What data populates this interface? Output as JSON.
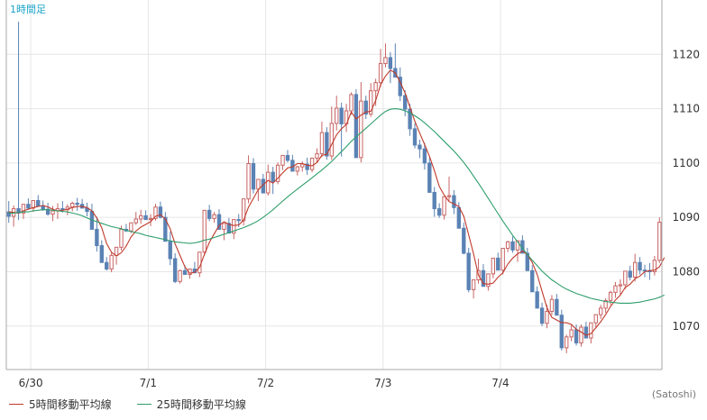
{
  "period_label": "1時間足",
  "credit": "(Satoshi)",
  "colors": {
    "up": "#c86464",
    "down": "#5a82b4",
    "ma5": "#c0392b",
    "ma25": "#2e9e6b",
    "grid": "#e6e6e6",
    "axis": "#aaaaaa",
    "label": "#1aa3c8"
  },
  "chart_data": {
    "type": "candlestick",
    "title": "",
    "xlabel": "",
    "ylabel": "",
    "ylim": [
      1062,
      1130
    ],
    "grid": true,
    "legend_position": "bottom-left",
    "y_ticks": [
      1070,
      1080,
      1090,
      1100,
      1110,
      1120
    ],
    "x_ticks": [
      "6/30",
      "7/1",
      "7/2",
      "7/3",
      "7/4"
    ],
    "ohlc": [
      [
        1091.0,
        1093.0,
        1089.0,
        1090.2
      ],
      [
        1090.2,
        1092.2,
        1088.3,
        1091.6
      ],
      [
        1091.6,
        1126.0,
        1089.5,
        1090.8
      ],
      [
        1090.8,
        1091.8,
        1089.7,
        1092.4
      ],
      [
        1092.4,
        1093.5,
        1091.4,
        1091.7
      ],
      [
        1091.7,
        1092.7,
        1091.0,
        1093.1
      ],
      [
        1093.1,
        1094.1,
        1092.5,
        1092.1
      ],
      [
        1092.1,
        1093.1,
        1091.2,
        1091.5
      ],
      [
        1091.5,
        1092.7,
        1090.3,
        1090.6
      ],
      [
        1090.6,
        1092.1,
        1089.3,
        1091.2
      ],
      [
        1091.2,
        1092.6,
        1089.7,
        1091.6
      ],
      [
        1091.6,
        1093.0,
        1090.9,
        1091.4
      ],
      [
        1091.4,
        1092.4,
        1090.4,
        1091.9
      ],
      [
        1091.9,
        1092.9,
        1091.1,
        1092.6
      ],
      [
        1092.6,
        1093.6,
        1091.2,
        1092.4
      ],
      [
        1092.4,
        1093.4,
        1091.9,
        1091.7
      ],
      [
        1091.7,
        1092.7,
        1090.2,
        1091.1
      ],
      [
        1091.1,
        1092.5,
        1088.9,
        1087.8
      ],
      [
        1087.8,
        1090.1,
        1083.7,
        1084.8
      ],
      [
        1084.8,
        1085.8,
        1083.5,
        1081.7
      ],
      [
        1081.7,
        1082.7,
        1080.2,
        1080.5
      ],
      [
        1080.5,
        1083.6,
        1079.9,
        1083.0
      ],
      [
        1083.0,
        1084.0,
        1081.3,
        1084.5
      ],
      [
        1084.5,
        1088.5,
        1083.9,
        1087.8
      ],
      [
        1087.8,
        1088.8,
        1087.3,
        1087.5
      ],
      [
        1087.5,
        1088.6,
        1087.1,
        1089.0
      ],
      [
        1089.0,
        1091.0,
        1088.6,
        1089.7
      ],
      [
        1089.7,
        1091.4,
        1088.8,
        1090.3
      ],
      [
        1090.3,
        1091.3,
        1089.6,
        1089.6
      ],
      [
        1089.6,
        1090.6,
        1088.4,
        1089.8
      ],
      [
        1089.8,
        1092.5,
        1089.4,
        1091.9
      ],
      [
        1091.9,
        1092.9,
        1089.8,
        1090.0
      ],
      [
        1090.0,
        1091.0,
        1087.6,
        1085.6
      ],
      [
        1085.6,
        1087.4,
        1081.2,
        1082.4
      ],
      [
        1082.4,
        1083.4,
        1077.9,
        1078.2
      ],
      [
        1078.2,
        1080.4,
        1077.8,
        1080.2
      ],
      [
        1080.2,
        1081.2,
        1079.6,
        1079.5
      ],
      [
        1079.5,
        1080.5,
        1078.7,
        1080.5
      ],
      [
        1080.5,
        1081.8,
        1079.8,
        1079.8
      ],
      [
        1079.8,
        1081.6,
        1079.0,
        1083.6
      ],
      [
        1083.6,
        1086.5,
        1083.0,
        1091.3
      ],
      [
        1091.3,
        1092.3,
        1089.3,
        1089.8
      ],
      [
        1089.8,
        1091.0,
        1089.0,
        1090.5
      ],
      [
        1090.5,
        1091.5,
        1088.3,
        1087.8
      ],
      [
        1087.8,
        1088.8,
        1085.8,
        1088.9
      ],
      [
        1088.9,
        1089.9,
        1087.4,
        1087.1
      ],
      [
        1087.1,
        1088.3,
        1086.0,
        1089.6
      ],
      [
        1089.6,
        1090.6,
        1088.2,
        1089.4
      ],
      [
        1089.4,
        1092.4,
        1088.5,
        1093.4
      ],
      [
        1093.4,
        1101.4,
        1092.6,
        1099.9
      ],
      [
        1099.9,
        1100.9,
        1094.4,
        1095.2
      ],
      [
        1095.2,
        1096.2,
        1093.0,
        1097.0
      ],
      [
        1097.0,
        1098.0,
        1094.4,
        1094.5
      ],
      [
        1094.5,
        1099.7,
        1094.0,
        1098.3
      ],
      [
        1098.3,
        1099.3,
        1094.3,
        1096.6
      ],
      [
        1096.6,
        1100.1,
        1096.1,
        1099.6
      ],
      [
        1099.6,
        1101.0,
        1098.7,
        1101.4
      ],
      [
        1101.4,
        1102.4,
        1100.1,
        1100.5
      ],
      [
        1100.5,
        1101.5,
        1098.6,
        1098.5
      ],
      [
        1098.5,
        1099.5,
        1097.7,
        1099.3
      ],
      [
        1099.3,
        1100.3,
        1098.4,
        1099.8
      ],
      [
        1099.8,
        1101.0,
        1097.8,
        1098.8
      ],
      [
        1098.8,
        1101.0,
        1098.3,
        1100.9
      ],
      [
        1100.9,
        1102.7,
        1100.1,
        1101.7
      ],
      [
        1101.7,
        1107.6,
        1101.1,
        1105.6
      ],
      [
        1105.6,
        1106.6,
        1100.6,
        1101.3
      ],
      [
        1101.3,
        1110.4,
        1100.6,
        1107.3
      ],
      [
        1107.3,
        1112.4,
        1106.0,
        1110.1
      ],
      [
        1110.1,
        1111.1,
        1101.2,
        1107.2
      ],
      [
        1107.2,
        1110.9,
        1105.7,
        1109.6
      ],
      [
        1109.6,
        1113.0,
        1108.9,
        1112.6
      ],
      [
        1112.6,
        1113.6,
        1102.4,
        1101.0
      ],
      [
        1101.0,
        1114.9,
        1100.1,
        1111.4
      ],
      [
        1111.4,
        1112.4,
        1108.1,
        1109.0
      ],
      [
        1109.0,
        1114.7,
        1108.5,
        1113.3
      ],
      [
        1113.3,
        1115.5,
        1110.5,
        1114.8
      ],
      [
        1114.8,
        1121.0,
        1114.0,
        1118.3
      ],
      [
        1118.3,
        1122.0,
        1117.6,
        1119.4
      ],
      [
        1119.4,
        1120.4,
        1114.7,
        1117.4
      ],
      [
        1117.4,
        1122.0,
        1116.5,
        1115.8
      ],
      [
        1115.8,
        1117.6,
        1111.4,
        1112.4
      ],
      [
        1112.4,
        1113.4,
        1108.6,
        1109.9
      ],
      [
        1109.9,
        1110.9,
        1105.0,
        1106.3
      ],
      [
        1106.3,
        1107.3,
        1102.7,
        1103.3
      ],
      [
        1103.3,
        1104.3,
        1100.9,
        1102.6
      ],
      [
        1102.6,
        1103.7,
        1098.8,
        1100.0
      ],
      [
        1100.0,
        1101.0,
        1095.1,
        1094.6
      ],
      [
        1094.6,
        1095.6,
        1090.1,
        1091.6
      ],
      [
        1091.6,
        1092.6,
        1089.9,
        1090.4
      ],
      [
        1090.4,
        1093.0,
        1089.6,
        1093.8
      ],
      [
        1093.8,
        1097.5,
        1093.0,
        1094.0
      ],
      [
        1094.0,
        1095.0,
        1090.6,
        1091.8
      ],
      [
        1091.8,
        1092.8,
        1088.3,
        1088.0
      ],
      [
        1088.0,
        1089.0,
        1083.2,
        1083.4
      ],
      [
        1083.4,
        1084.4,
        1076.2,
        1076.7
      ],
      [
        1076.7,
        1077.7,
        1075.1,
        1078.5
      ],
      [
        1078.5,
        1082.4,
        1077.8,
        1080.2
      ],
      [
        1080.2,
        1081.4,
        1077.5,
        1077.3
      ],
      [
        1077.3,
        1078.3,
        1076.5,
        1079.6
      ],
      [
        1079.6,
        1081.0,
        1078.8,
        1082.5
      ],
      [
        1082.5,
        1083.5,
        1080.8,
        1080.3
      ],
      [
        1080.3,
        1083.7,
        1079.5,
        1084.3
      ],
      [
        1084.3,
        1085.7,
        1083.6,
        1085.5
      ],
      [
        1085.5,
        1086.5,
        1083.5,
        1084.0
      ],
      [
        1084.0,
        1085.0,
        1081.8,
        1085.7
      ],
      [
        1085.7,
        1086.7,
        1083.4,
        1083.4
      ],
      [
        1083.4,
        1084.4,
        1080.5,
        1080.2
      ],
      [
        1080.2,
        1081.2,
        1076.5,
        1076.3
      ],
      [
        1076.3,
        1077.3,
        1074.5,
        1073.3
      ],
      [
        1073.3,
        1074.3,
        1070.0,
        1070.5
      ],
      [
        1070.5,
        1073.9,
        1069.6,
        1072.7
      ],
      [
        1072.7,
        1075.7,
        1072.0,
        1074.9
      ],
      [
        1074.9,
        1075.9,
        1072.2,
        1072.0
      ],
      [
        1072.0,
        1073.0,
        1065.5,
        1066.0
      ],
      [
        1066.0,
        1068.4,
        1065.0,
        1068.0
      ],
      [
        1068.0,
        1070.2,
        1067.2,
        1069.3
      ],
      [
        1069.3,
        1070.3,
        1066.4,
        1066.9
      ],
      [
        1066.9,
        1070.3,
        1066.2,
        1069.8
      ],
      [
        1069.8,
        1070.8,
        1068.2,
        1067.8
      ],
      [
        1067.8,
        1070.1,
        1066.8,
        1070.6
      ],
      [
        1070.6,
        1072.2,
        1069.8,
        1072.1
      ],
      [
        1072.1,
        1073.9,
        1071.3,
        1073.3
      ],
      [
        1073.3,
        1075.1,
        1072.4,
        1074.7
      ],
      [
        1074.7,
        1076.5,
        1073.9,
        1076.2
      ],
      [
        1076.2,
        1078.1,
        1075.2,
        1077.4
      ],
      [
        1077.4,
        1078.6,
        1075.8,
        1077.6
      ],
      [
        1077.6,
        1080.0,
        1076.8,
        1080.1
      ],
      [
        1080.1,
        1081.1,
        1078.4,
        1079.0
      ],
      [
        1079.0,
        1083.3,
        1078.2,
        1081.7
      ],
      [
        1081.7,
        1082.7,
        1079.5,
        1080.3
      ],
      [
        1080.3,
        1081.3,
        1079.0,
        1080.2
      ],
      [
        1080.2,
        1081.6,
        1078.5,
        1080.0
      ],
      [
        1080.0,
        1082.9,
        1079.3,
        1082.1
      ],
      [
        1082.1,
        1090.0,
        1081.6,
        1089.1
      ]
    ],
    "series": [
      {
        "name": "5時間移動平均線",
        "values": [
          1091.0,
          1090.9,
          1090.8,
          1091.2,
          1091.5,
          1091.8,
          1092.0,
          1092.2,
          1091.9,
          1091.5,
          1091.2,
          1091.3,
          1091.5,
          1091.8,
          1092.0,
          1092.0,
          1091.8,
          1091.2,
          1089.9,
          1088.1,
          1085.2,
          1083.6,
          1082.9,
          1083.5,
          1084.7,
          1086.4,
          1087.5,
          1088.2,
          1088.7,
          1089.2,
          1090.2,
          1090.5,
          1089.7,
          1087.9,
          1085.1,
          1083.0,
          1080.9,
          1079.7,
          1079.9,
          1080.8,
          1083.2,
          1085.4,
          1087.0,
          1088.5,
          1089.2,
          1088.7,
          1088.5,
          1088.6,
          1089.5,
          1091.9,
          1093.5,
          1095.1,
          1096.0,
          1096.8,
          1096.3,
          1097.2,
          1098.2,
          1099.1,
          1099.3,
          1099.9,
          1099.9,
          1099.6,
          1099.5,
          1100.1,
          1101.4,
          1101.6,
          1103.4,
          1105.2,
          1106.3,
          1107.1,
          1109.4,
          1108.1,
          1108.8,
          1109.4,
          1109.5,
          1111.5,
          1114.4,
          1116.0,
          1117.1,
          1116.6,
          1114.9,
          1112.9,
          1110.3,
          1107.7,
          1105.5,
          1103.4,
          1101.2,
          1098.6,
          1095.7,
          1094.1,
          1092.9,
          1092.5,
          1092.0,
          1090.2,
          1086.8,
          1083.3,
          1079.4,
          1077.8,
          1077.7,
          1077.9,
          1079.0,
          1079.8,
          1081.4,
          1082.5,
          1083.3,
          1083.8,
          1083.2,
          1081.7,
          1079.5,
          1076.4,
          1073.4,
          1071.6,
          1071.1,
          1070.6,
          1070.6,
          1070.3,
          1069.4,
          1068.9,
          1068.3,
          1068.6,
          1069.7,
          1070.8,
          1072.1,
          1073.6,
          1074.8,
          1075.7,
          1077.1,
          1077.7,
          1078.7,
          1079.2,
          1080.0,
          1080.2,
          1080.3,
          1080.9,
          1082.6
        ]
      },
      {
        "name": "25時間移動平均線",
        "values": [
          1090.8,
          1090.8,
          1090.9,
          1091.0,
          1091.0,
          1091.2,
          1091.3,
          1091.4,
          1091.4,
          1091.3,
          1091.2,
          1091.1,
          1091.0,
          1090.8,
          1090.6,
          1090.3,
          1089.9,
          1089.5,
          1089.2,
          1088.9,
          1088.6,
          1088.3,
          1088.1,
          1087.9,
          1087.6,
          1087.4,
          1087.2,
          1087.0,
          1086.7,
          1086.5,
          1086.3,
          1086.1,
          1085.9,
          1085.7,
          1085.5,
          1085.4,
          1085.3,
          1085.2,
          1085.3,
          1085.5,
          1085.8,
          1086.0,
          1086.3,
          1086.6,
          1086.9,
          1087.2,
          1087.5,
          1087.8,
          1088.1,
          1088.5,
          1088.9,
          1089.4,
          1090.0,
          1090.7,
          1091.4,
          1092.2,
          1093.0,
          1093.8,
          1094.5,
          1095.2,
          1095.9,
          1096.6,
          1097.3,
          1098.0,
          1098.7,
          1099.5,
          1100.3,
          1101.2,
          1102.1,
          1103.0,
          1104.0,
          1104.8,
          1105.6,
          1106.4,
          1107.2,
          1108.0,
          1108.8,
          1109.5,
          1109.9,
          1110.0,
          1109.9,
          1109.6,
          1109.2,
          1108.7,
          1108.1,
          1107.4,
          1106.6,
          1105.8,
          1104.9,
          1104.0,
          1103.1,
          1102.2,
          1101.2,
          1100.1,
          1098.9,
          1097.6,
          1096.3,
          1094.9,
          1093.5,
          1092.1,
          1090.7,
          1089.3,
          1088.0,
          1086.7,
          1085.5,
          1084.3,
          1083.2,
          1082.1,
          1081.1,
          1080.1,
          1079.3,
          1078.5,
          1077.9,
          1077.3,
          1076.8,
          1076.4,
          1076.0,
          1075.7,
          1075.4,
          1075.1,
          1074.9,
          1074.7,
          1074.5,
          1074.4,
          1074.3,
          1074.2,
          1074.2,
          1074.2,
          1074.3,
          1074.4,
          1074.6,
          1074.8,
          1075.0,
          1075.3,
          1075.7
        ]
      }
    ]
  }
}
